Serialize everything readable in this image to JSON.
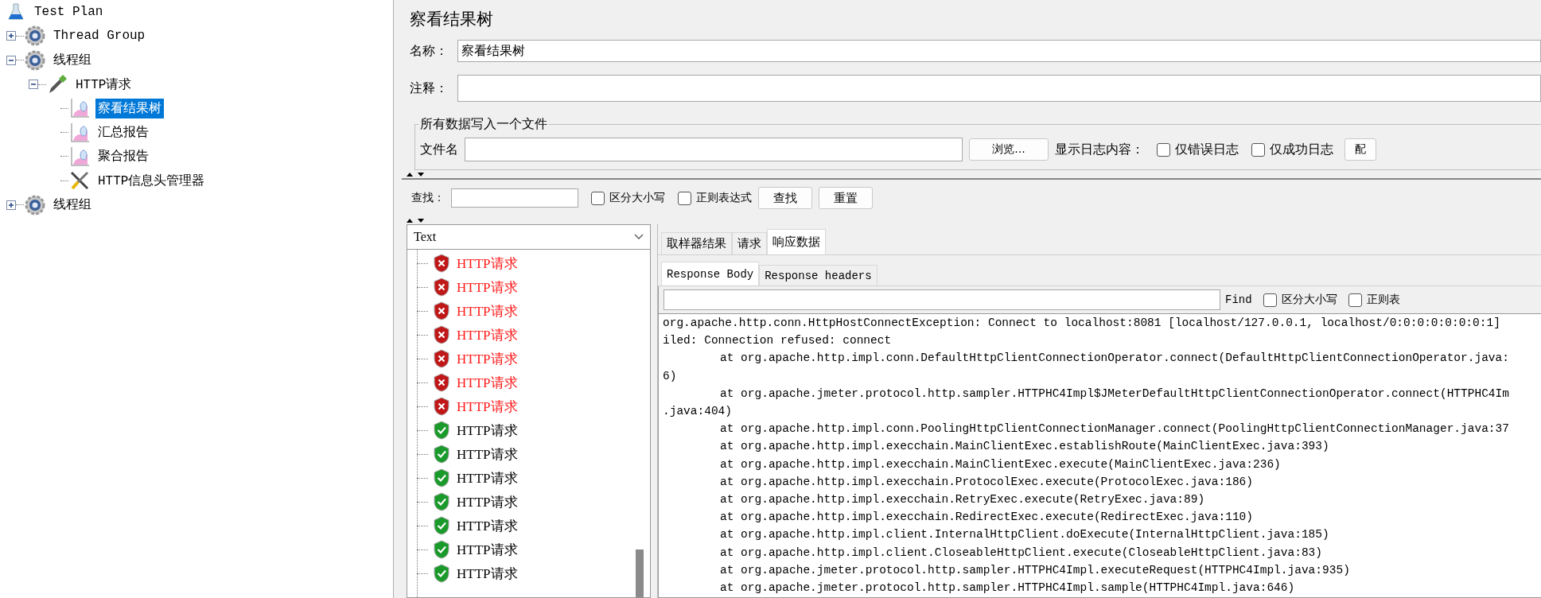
{
  "tree": [
    {
      "label": "Test Plan",
      "kind": "plan",
      "selected": false,
      "children": [
        {
          "label": "Thread Group",
          "kind": "thread_group",
          "expanded": false,
          "selected": false
        },
        {
          "label": "线程组",
          "kind": "thread_group",
          "expanded": true,
          "selected": false,
          "children": [
            {
              "label": "HTTP请求",
              "kind": "sampler",
              "expanded": true,
              "selected": false,
              "children": [
                {
                  "label": "察看结果树",
                  "kind": "listener",
                  "selected": true
                },
                {
                  "label": "汇总报告",
                  "kind": "listener",
                  "selected": false
                },
                {
                  "label": "聚合报告",
                  "kind": "listener",
                  "selected": false
                },
                {
                  "label": "HTTP信息头管理器",
                  "kind": "config",
                  "selected": false
                }
              ]
            }
          ]
        },
        {
          "label": "线程组",
          "kind": "thread_group",
          "expanded": false,
          "selected": false
        }
      ]
    }
  ],
  "panel": {
    "title": "察看结果树",
    "name_label": "名称：",
    "name_value": "察看结果树",
    "comment_label": "注释：",
    "file_group": {
      "title": "所有数据写入一个文件",
      "file_label": "文件名",
      "browse_button": "浏览...",
      "log_label": "显示日志内容：",
      "checkboxes": [
        {
          "label": "仅错误日志",
          "checked": false
        },
        {
          "label": "仅成功日志",
          "checked": false
        }
      ],
      "config_button": "配"
    },
    "search": {
      "label": "查找：",
      "checkboxes": [
        {
          "label": "区分大小写",
          "checked": false
        },
        {
          "label": "正则表达式",
          "checked": false
        }
      ],
      "buttons": [
        "查找",
        "重置"
      ]
    },
    "renderer": "Text",
    "results": [
      {
        "label": "HTTP请求",
        "failed": true
      },
      {
        "label": "HTTP请求",
        "failed": true
      },
      {
        "label": "HTTP请求",
        "failed": true
      },
      {
        "label": "HTTP请求",
        "failed": true
      },
      {
        "label": "HTTP请求",
        "failed": true
      },
      {
        "label": "HTTP请求",
        "failed": true
      },
      {
        "label": "HTTP请求",
        "failed": true
      },
      {
        "label": "HTTP请求",
        "failed": false
      },
      {
        "label": "HTTP请求",
        "failed": false
      },
      {
        "label": "HTTP请求",
        "failed": false
      },
      {
        "label": "HTTP请求",
        "failed": false
      },
      {
        "label": "HTTP请求",
        "failed": false
      },
      {
        "label": "HTTP请求",
        "failed": false
      },
      {
        "label": "HTTP请求",
        "failed": false
      }
    ],
    "tabs": [
      {
        "label": "取样器结果",
        "selected": false
      },
      {
        "label": "请求",
        "selected": false
      },
      {
        "label": "响应数据",
        "selected": true
      }
    ],
    "subtabs": [
      {
        "label": "Response Body",
        "selected": true
      },
      {
        "label": "Response headers",
        "selected": false
      }
    ],
    "find": {
      "label": "Find",
      "checkboxes": [
        {
          "label": "区分大小写",
          "checked": false
        },
        {
          "label": "正则表",
          "checked": false
        }
      ]
    },
    "body_lines": [
      {
        "kind": "text",
        "text": "org.apache.http.conn.HttpHostConnectException: Connect to localhost:8081 [localhost/127.0.0.1, localhost/0:0:0:0:0:0:0:1]"
      },
      {
        "kind": "text",
        "text": "iled: Connection refused: connect"
      },
      {
        "kind": "frame",
        "text": "at org.apache.http.impl.conn.DefaultHttpClientConnectionOperator.connect(DefaultHttpClientConnectionOperator.java:"
      },
      {
        "kind": "text",
        "text": "6)"
      },
      {
        "kind": "frame",
        "text": "at org.apache.jmeter.protocol.http.sampler.HTTPHC4Impl$JMeterDefaultHttpClientConnectionOperator.connect(HTTPHC4Im"
      },
      {
        "kind": "text",
        "text": ".java:404)"
      },
      {
        "kind": "frame",
        "text": "at org.apache.http.impl.conn.PoolingHttpClientConnectionManager.connect(PoolingHttpClientConnectionManager.java:37"
      },
      {
        "kind": "frame",
        "text": "at org.apache.http.impl.execchain.MainClientExec.establishRoute(MainClientExec.java:393)"
      },
      {
        "kind": "frame",
        "text": "at org.apache.http.impl.execchain.MainClientExec.execute(MainClientExec.java:236)"
      },
      {
        "kind": "frame",
        "text": "at org.apache.http.impl.execchain.ProtocolExec.execute(ProtocolExec.java:186)"
      },
      {
        "kind": "frame",
        "text": "at org.apache.http.impl.execchain.RetryExec.execute(RetryExec.java:89)"
      },
      {
        "kind": "frame",
        "text": "at org.apache.http.impl.execchain.RedirectExec.execute(RedirectExec.java:110)"
      },
      {
        "kind": "frame",
        "text": "at org.apache.http.impl.client.InternalHttpClient.doExecute(InternalHttpClient.java:185)"
      },
      {
        "kind": "frame",
        "text": "at org.apache.http.impl.client.CloseableHttpClient.execute(CloseableHttpClient.java:83)"
      },
      {
        "kind": "frame",
        "text": "at org.apache.jmeter.protocol.http.sampler.HTTPHC4Impl.executeRequest(HTTPHC4Impl.java:935)"
      },
      {
        "kind": "frame",
        "text": "at org.apache.jmeter.protocol.http.sampler.HTTPHC4Impl.sample(HTTPHC4Impl.java:646)"
      }
    ]
  }
}
